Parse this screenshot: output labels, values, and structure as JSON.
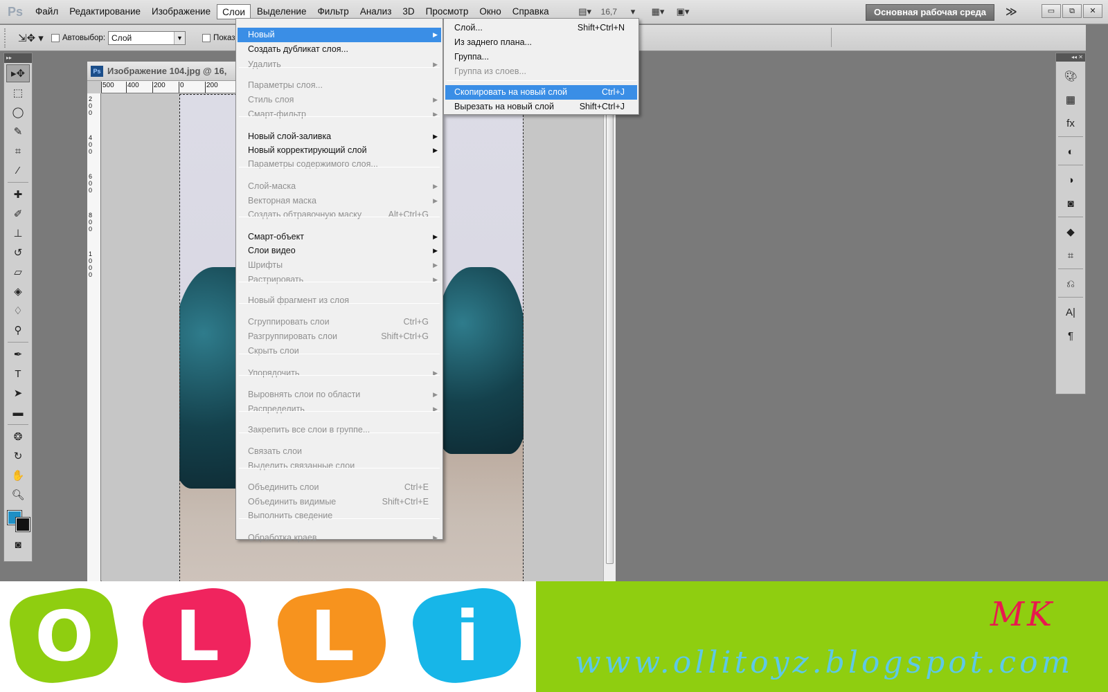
{
  "app": {
    "logo": "Ps",
    "menus": [
      "Файл",
      "Редактирование",
      "Изображение",
      "Слои",
      "Выделение",
      "Фильтр",
      "Анализ",
      "3D",
      "Просмотр",
      "Окно",
      "Справка"
    ],
    "active_menu": "Слои",
    "zoom": "16,7",
    "workspace": "Основная рабочая среда",
    "more": "≫",
    "window_buttons": {
      "minimize": "▭",
      "restore": "⧉",
      "close": "✕"
    }
  },
  "options": {
    "autoselect_label": "Автовыбор:",
    "autoselect_value": "Слой",
    "show_label": "Показ"
  },
  "document": {
    "title": "Изображение 104.jpg @ 16,",
    "ruler_h": [
      "500",
      "400",
      "200",
      "0",
      "200"
    ],
    "ruler_v": [
      "2",
      "0",
      "0",
      "4",
      "0",
      "0",
      "6",
      "0",
      "0",
      "8",
      "0",
      "0",
      "1",
      "0",
      "0",
      "0"
    ]
  },
  "layer_menu": {
    "items": [
      {
        "label": "Новый",
        "shortcut": "",
        "submenu": true,
        "disabled": false,
        "highlight": true
      },
      {
        "label": "Создать дубликат слоя...",
        "shortcut": "",
        "submenu": false,
        "disabled": false
      },
      {
        "label": "Удалить",
        "shortcut": "",
        "submenu": true,
        "disabled": true
      },
      {
        "label": "Параметры слоя...",
        "shortcut": "",
        "submenu": false,
        "disabled": true
      },
      {
        "label": "Стиль слоя",
        "shortcut": "",
        "submenu": true,
        "disabled": true
      },
      {
        "label": "Смарт-фильтр",
        "shortcut": "",
        "submenu": true,
        "disabled": true
      },
      {
        "label": "Новый слой-заливка",
        "shortcut": "",
        "submenu": true,
        "disabled": false
      },
      {
        "label": "Новый корректирующий слой",
        "shortcut": "",
        "submenu": true,
        "disabled": false
      },
      {
        "label": "Параметры содержимого слоя...",
        "shortcut": "",
        "submenu": false,
        "disabled": true
      },
      {
        "label": "Слой-маска",
        "shortcut": "",
        "submenu": true,
        "disabled": true
      },
      {
        "label": "Векторная маска",
        "shortcut": "",
        "submenu": true,
        "disabled": true
      },
      {
        "label": "Создать обтравочную маску",
        "shortcut": "Alt+Ctrl+G",
        "submenu": false,
        "disabled": true
      },
      {
        "label": "Смарт-объект",
        "shortcut": "",
        "submenu": true,
        "disabled": false
      },
      {
        "label": "Слои видео",
        "shortcut": "",
        "submenu": true,
        "disabled": false
      },
      {
        "label": "Шрифты",
        "shortcut": "",
        "submenu": true,
        "disabled": true
      },
      {
        "label": "Растрировать",
        "shortcut": "",
        "submenu": true,
        "disabled": true
      },
      {
        "label": "Новый фрагмент из слоя",
        "shortcut": "",
        "submenu": false,
        "disabled": true
      },
      {
        "label": "Сгруппировать слои",
        "shortcut": "Ctrl+G",
        "submenu": false,
        "disabled": true
      },
      {
        "label": "Разгруппировать слои",
        "shortcut": "Shift+Ctrl+G",
        "submenu": false,
        "disabled": true
      },
      {
        "label": "Скрыть слои",
        "shortcut": "",
        "submenu": false,
        "disabled": true
      },
      {
        "label": "Упорядочить",
        "shortcut": "",
        "submenu": true,
        "disabled": true
      },
      {
        "label": "Выровнять слои по области",
        "shortcut": "",
        "submenu": true,
        "disabled": true
      },
      {
        "label": "Распределить",
        "shortcut": "",
        "submenu": true,
        "disabled": true
      },
      {
        "label": "Закрепить все слои в группе...",
        "shortcut": "",
        "submenu": false,
        "disabled": true
      },
      {
        "label": "Связать слои",
        "shortcut": "",
        "submenu": false,
        "disabled": true
      },
      {
        "label": "Выделить связанные слои",
        "shortcut": "",
        "submenu": false,
        "disabled": true
      },
      {
        "label": "Объединить слои",
        "shortcut": "Ctrl+E",
        "submenu": false,
        "disabled": true
      },
      {
        "label": "Объединить видимые",
        "shortcut": "Shift+Ctrl+E",
        "submenu": false,
        "disabled": true
      },
      {
        "label": "Выполнить сведение",
        "shortcut": "",
        "submenu": false,
        "disabled": true
      },
      {
        "label": "Обработка краев",
        "shortcut": "",
        "submenu": true,
        "disabled": true
      }
    ]
  },
  "new_submenu": {
    "items": [
      {
        "label": "Слой...",
        "shortcut": "Shift+Ctrl+N",
        "disabled": false
      },
      {
        "label": "Из заднего плана...",
        "shortcut": "",
        "disabled": false
      },
      {
        "label": "Группа...",
        "shortcut": "",
        "disabled": false
      },
      {
        "label": "Группа из слоев...",
        "shortcut": "",
        "disabled": true
      },
      {
        "label": "Скопировать на новый слой",
        "shortcut": "Ctrl+J",
        "disabled": false,
        "highlight": true
      },
      {
        "label": "Вырезать на новый слой",
        "shortcut": "Shift+Ctrl+J",
        "disabled": false
      }
    ]
  },
  "colors": {
    "foreground": "#1f8fc4",
    "background": "#111111",
    "highlight": "#3a8ee6"
  },
  "banner": {
    "letters": [
      {
        "char": "O",
        "color": "#8fce10"
      },
      {
        "char": "L",
        "color": "#f0245e"
      },
      {
        "char": "L",
        "color": "#f7931e"
      },
      {
        "char": "i",
        "color": "#17b6e8"
      }
    ],
    "mk": "MK",
    "url": "www.ollitoyz.blogspot.com"
  }
}
